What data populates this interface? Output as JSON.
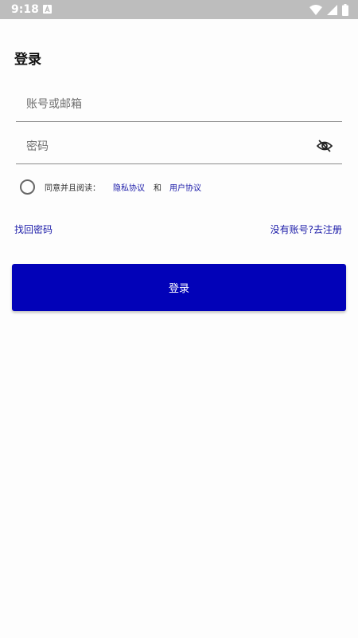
{
  "status_bar": {
    "time": "9:18",
    "icons": [
      "notification-a-icon",
      "wifi-icon",
      "cellular-icon",
      "battery-icon"
    ]
  },
  "page": {
    "title": "登录"
  },
  "form": {
    "account_placeholder": "账号或邮箱",
    "password_placeholder": "密码",
    "password_toggle_icon": "eye-off-icon",
    "agree_prefix": "同意并且阅读：",
    "privacy_link": "隐私协议",
    "and_text": "和",
    "user_agreement_link": "用户协议",
    "forgot_password": "找回密码",
    "register": "没有账号?去注册",
    "login_button": "登录"
  },
  "colors": {
    "accent": "#0202b8",
    "link": "#1a1aa8",
    "status_bar": "#bdbdbd"
  }
}
